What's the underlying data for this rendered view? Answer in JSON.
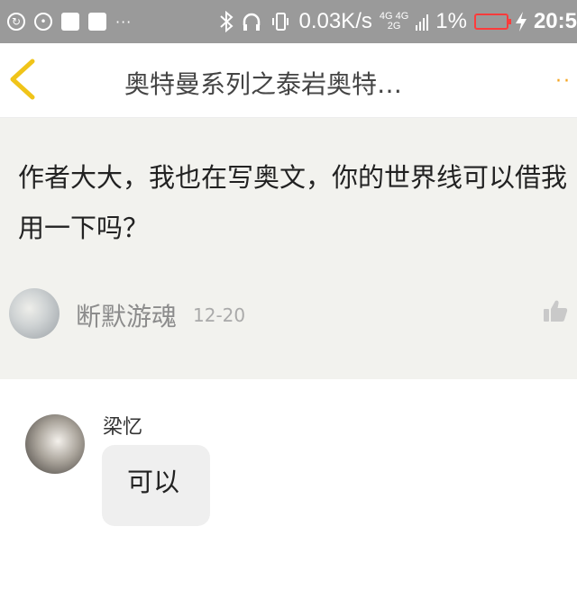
{
  "status_bar": {
    "net_speed": "0.03K/s",
    "network_top": "4G 4G",
    "network_bottom": "2G",
    "battery_percent": "1%",
    "time": "20:5",
    "battery_color": "#ff3b3b"
  },
  "header": {
    "title": "奥特曼系列之泰岩奥特…",
    "more_label": "··"
  },
  "comment": {
    "text": "作者大大，我也在写奥文，你的世界线可以借我用一下吗？",
    "author": "断默游魂",
    "date": "12-20"
  },
  "reply": {
    "author": "梁忆",
    "text": "可以"
  },
  "colors": {
    "status_bar_bg": "#9a9a9a",
    "back_arrow": "#f0c419",
    "comment_bg": "#f2f2ee",
    "more_dots": "#f5a623"
  }
}
